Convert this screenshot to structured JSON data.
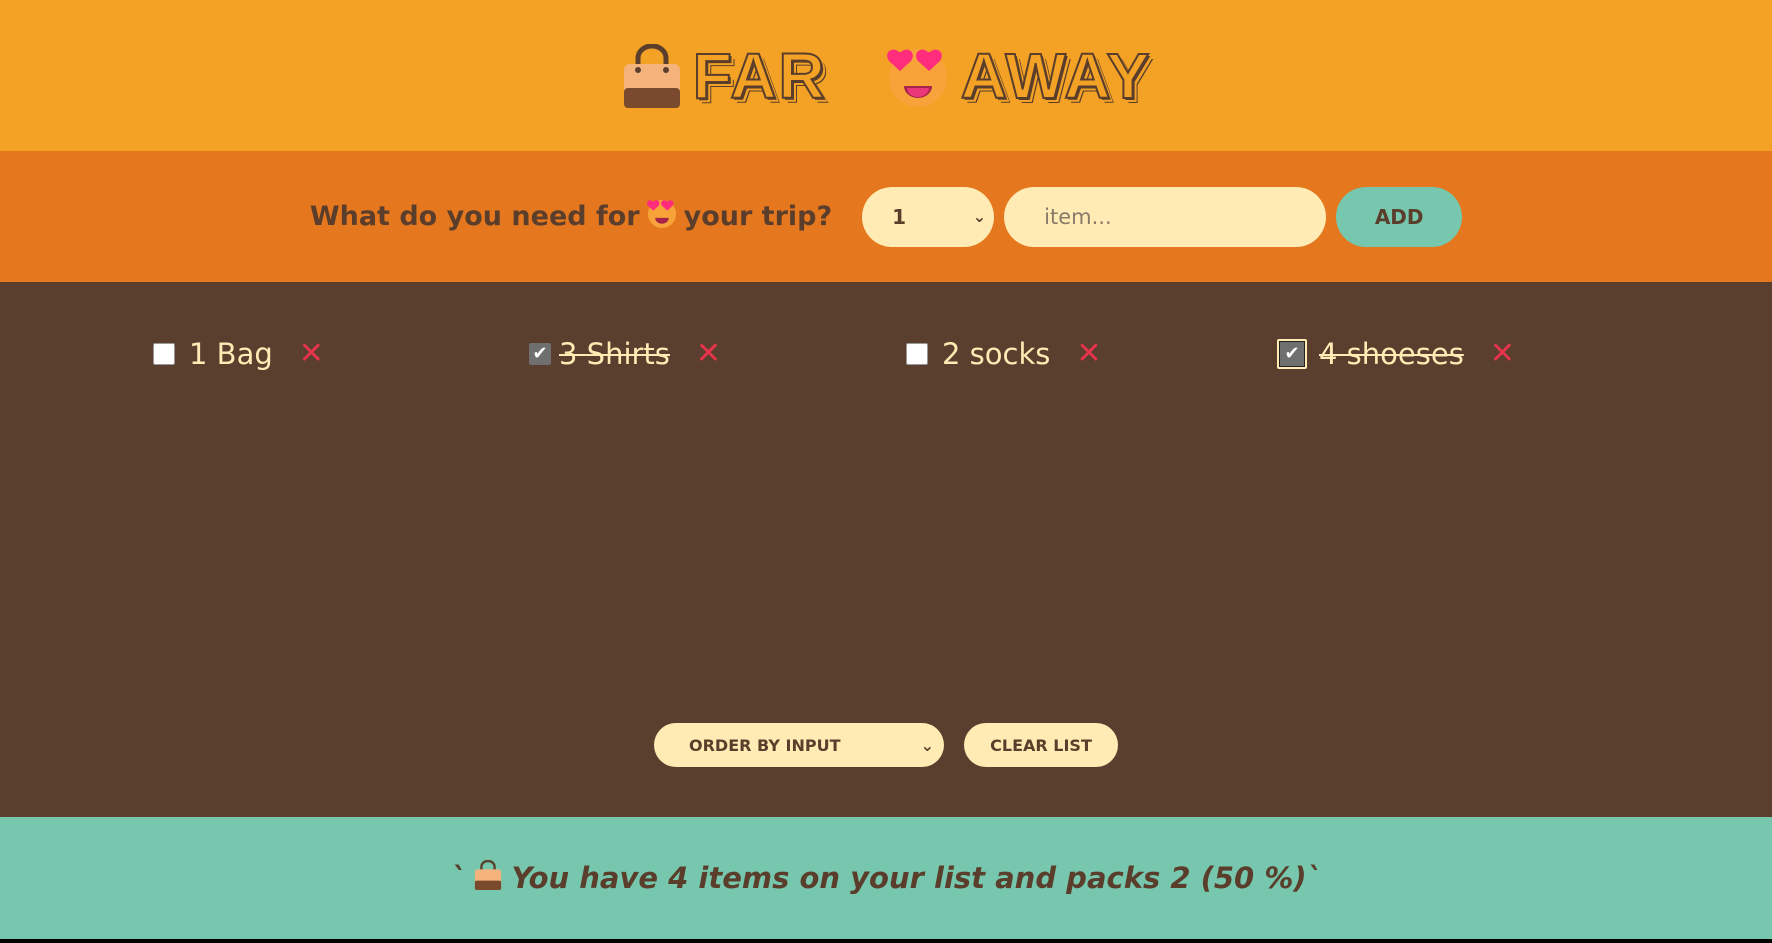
{
  "header": {
    "title_left": "FAR",
    "title_right": "AWAY",
    "icons": [
      "handbag-icon",
      "heart-eyes-face-icon"
    ]
  },
  "form": {
    "question": "What do you need for",
    "question_end": "your trip?",
    "quantity_value": "1",
    "item_placeholder": "item...",
    "add_label": "ADD"
  },
  "items": [
    {
      "label": "1 Bag",
      "packed": false
    },
    {
      "label": "3 Shirts",
      "packed": true
    },
    {
      "label": "2 socks",
      "packed": false
    },
    {
      "label": "4 shoeses",
      "packed": true
    }
  ],
  "actions": {
    "sort_value": "ORDER BY INPUT",
    "clear_label": "CLEAR LIST"
  },
  "stats": {
    "prefix": "`",
    "text": "You have 4 items on your list and packs 2 (50 %)`"
  },
  "colors": {
    "header_bg": "#f4a226",
    "form_bg": "#e5771e",
    "list_bg": "#5a3e2e",
    "stats_bg": "#76c7ad",
    "cream": "#ffebb3",
    "delete_red": "#e5344b"
  }
}
